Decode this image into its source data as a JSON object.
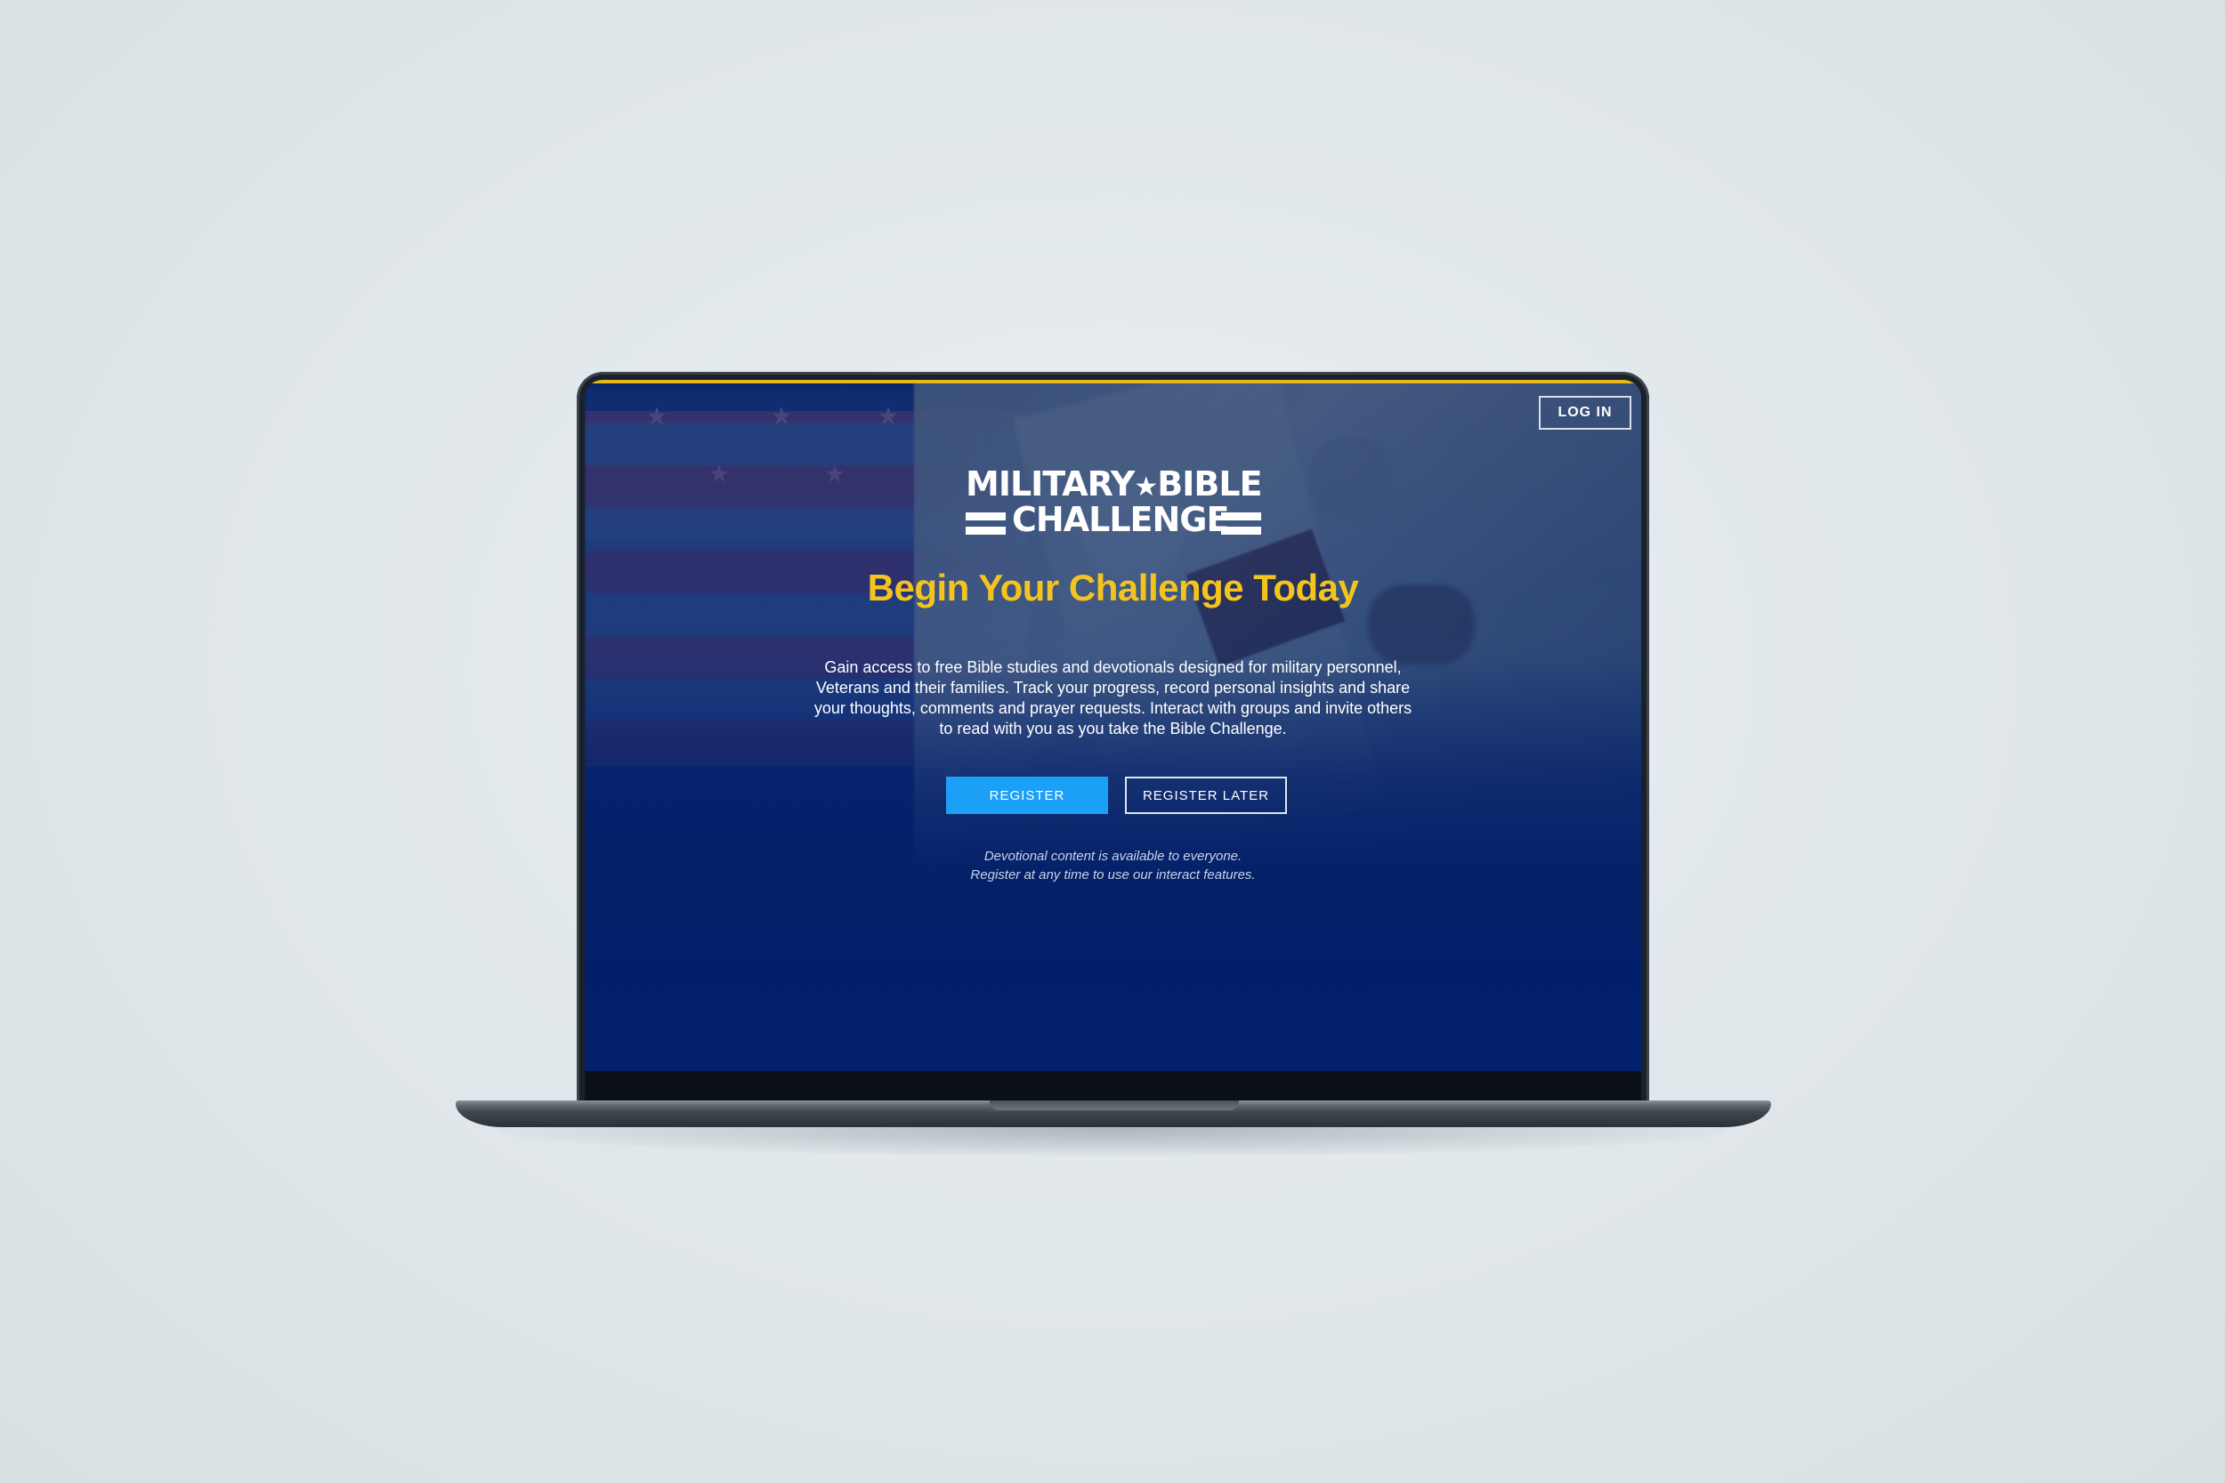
{
  "header": {
    "login_label": "LOG IN"
  },
  "brand": {
    "line1_left": "MILITARY",
    "line1_right": "BIBLE",
    "line2": "CHALLENGE"
  },
  "hero": {
    "headline": "Begin Your Challenge Today",
    "description": "Gain access to free Bible studies and devotionals designed for military personnel, Veterans and their families. Track your progress, record personal insights and share your thoughts, comments and prayer requests. Interact with groups and invite others to read with you as you take the Bible Challenge.",
    "register_label": "REGISTER",
    "register_later_label": "REGISTER LATER",
    "note_line1": "Devotional content is available to everyone.",
    "note_line2": "Register at any time to use our interact features."
  },
  "colors": {
    "accent_yellow": "#f4c41e",
    "primary_blue": "#1c9ff7",
    "navy": "#02216a"
  }
}
